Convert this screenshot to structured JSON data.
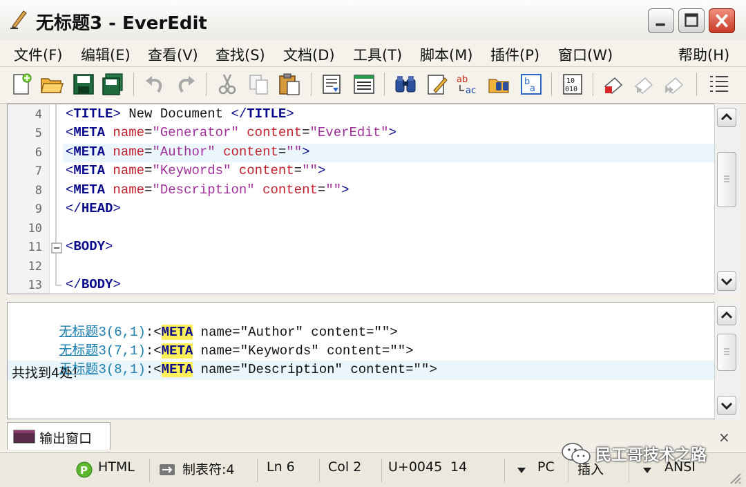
{
  "window": {
    "title": "无标题3 - EverEdit"
  },
  "menu": {
    "items": [
      "文件(F)",
      "编辑(E)",
      "查看(V)",
      "查找(S)",
      "文档(D)",
      "工具(T)",
      "脚本(M)",
      "插件(P)",
      "窗口(W)",
      "帮助(H)"
    ]
  },
  "toolbar": {
    "icons": [
      "new-file-icon",
      "open-folder-icon",
      "save-icon",
      "save-all-icon",
      "undo-icon",
      "redo-icon",
      "cut-icon",
      "copy-icon",
      "paste-icon",
      "insert-file-icon",
      "list-view-icon",
      "find-binoculars-icon",
      "edit-document-icon",
      "replace-abc-icon",
      "find-in-files-icon",
      "ba-convert-icon",
      "hex-mode-icon",
      "macro-record-icon",
      "macro-play-icon",
      "macro-play-multiple-icon",
      "outline-icon"
    ]
  },
  "editor": {
    "line_numbers": [
      "4",
      "5",
      "6",
      "7",
      "8",
      "9",
      "10",
      "11",
      "12",
      "13"
    ],
    "current_line": "6",
    "lines": [
      {
        "parts": [
          {
            "c": "brk",
            "t": "<"
          },
          {
            "c": "tag",
            "t": "TITLE"
          },
          {
            "c": "brk",
            "t": ">"
          },
          {
            "c": "plain",
            "t": " New Document "
          },
          {
            "c": "brk",
            "t": "</"
          },
          {
            "c": "tag",
            "t": "TITLE"
          },
          {
            "c": "brk",
            "t": ">"
          }
        ]
      },
      {
        "parts": [
          {
            "c": "brk",
            "t": "<"
          },
          {
            "c": "tag",
            "t": "META"
          },
          {
            "c": "plain",
            "t": " "
          },
          {
            "c": "attr",
            "t": "name"
          },
          {
            "c": "plain",
            "t": "="
          },
          {
            "c": "str",
            "t": "\"Generator\""
          },
          {
            "c": "plain",
            "t": " "
          },
          {
            "c": "attr",
            "t": "content"
          },
          {
            "c": "plain",
            "t": "="
          },
          {
            "c": "str",
            "t": "\"EverEdit\""
          },
          {
            "c": "brk",
            "t": ">"
          }
        ]
      },
      {
        "parts": [
          {
            "c": "brk",
            "t": "<"
          },
          {
            "c": "tag",
            "t": "META"
          },
          {
            "c": "plain",
            "t": " "
          },
          {
            "c": "attr",
            "t": "name"
          },
          {
            "c": "plain",
            "t": "="
          },
          {
            "c": "str",
            "t": "\"Author\""
          },
          {
            "c": "plain",
            "t": " "
          },
          {
            "c": "attr",
            "t": "content"
          },
          {
            "c": "plain",
            "t": "="
          },
          {
            "c": "str",
            "t": "\"\""
          },
          {
            "c": "brk",
            "t": ">"
          }
        ]
      },
      {
        "parts": [
          {
            "c": "brk",
            "t": "<"
          },
          {
            "c": "tag",
            "t": "META"
          },
          {
            "c": "plain",
            "t": " "
          },
          {
            "c": "attr",
            "t": "name"
          },
          {
            "c": "plain",
            "t": "="
          },
          {
            "c": "str",
            "t": "\"Keywords\""
          },
          {
            "c": "plain",
            "t": " "
          },
          {
            "c": "attr",
            "t": "content"
          },
          {
            "c": "plain",
            "t": "="
          },
          {
            "c": "str",
            "t": "\"\""
          },
          {
            "c": "brk",
            "t": ">"
          }
        ]
      },
      {
        "parts": [
          {
            "c": "brk",
            "t": "<"
          },
          {
            "c": "tag",
            "t": "META"
          },
          {
            "c": "plain",
            "t": " "
          },
          {
            "c": "attr",
            "t": "name"
          },
          {
            "c": "plain",
            "t": "="
          },
          {
            "c": "str",
            "t": "\"Description\""
          },
          {
            "c": "plain",
            "t": " "
          },
          {
            "c": "attr",
            "t": "content"
          },
          {
            "c": "plain",
            "t": "="
          },
          {
            "c": "str",
            "t": "\"\""
          },
          {
            "c": "brk",
            "t": ">"
          }
        ]
      },
      {
        "parts": [
          {
            "c": "brk",
            "t": "</"
          },
          {
            "c": "tag",
            "t": "HEAD"
          },
          {
            "c": "brk",
            "t": ">"
          }
        ]
      },
      {
        "parts": []
      },
      {
        "parts": [
          {
            "c": "brk",
            "t": "<"
          },
          {
            "c": "tag",
            "t": "BODY"
          },
          {
            "c": "brk",
            "t": ">"
          }
        ]
      },
      {
        "parts": []
      },
      {
        "parts": [
          {
            "c": "brk",
            "t": "</"
          },
          {
            "c": "tag",
            "t": "BODY"
          },
          {
            "c": "brk",
            "t": ">"
          }
        ]
      }
    ]
  },
  "output": {
    "results": [
      {
        "file": "无标题",
        "loc": "3(6,1)",
        "sep": ":<",
        "match": "META",
        "rest": " name=\"Author\" content=\"\">"
      },
      {
        "file": "无标题",
        "loc": "3(7,1)",
        "sep": ":<",
        "match": "META",
        "rest": " name=\"Keywords\" content=\"\">"
      },
      {
        "file": "无标题",
        "loc": "3(8,1)",
        "sep": ":<",
        "match": "META",
        "rest": " name=\"Description\" content=\"\">"
      }
    ],
    "summary": "共找到4处!"
  },
  "output_tab": {
    "label": "输出窗口",
    "close": "×"
  },
  "status": {
    "syntax": "HTML",
    "tab_setting": "制表符:4",
    "line": "Ln 6",
    "col": "Col 2",
    "unicode": "U+0045",
    "num": "14",
    "line_ending": "PC",
    "mode": "插入",
    "encoding": "ANSI"
  },
  "watermark": {
    "text": "民工哥技术之路"
  }
}
